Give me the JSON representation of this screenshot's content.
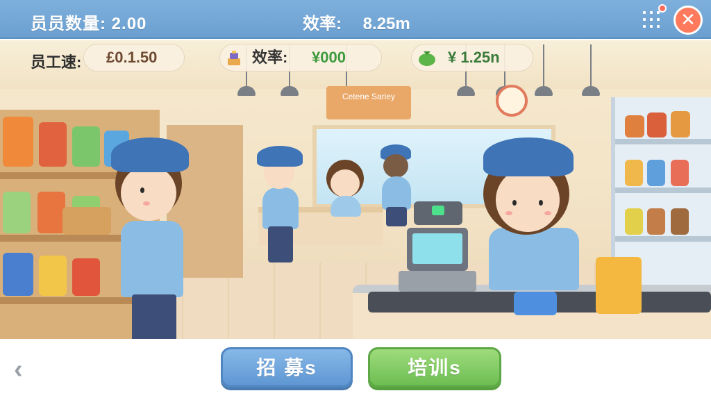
{
  "topbar": {
    "staff_count_label": "员员数量:",
    "staff_count_value": "2.00",
    "efficiency_label": "效率:",
    "efficiency_value": "8.25m",
    "menu_icon": "grid-icon",
    "close_icon": "close-icon",
    "close_glyph": "✕",
    "accent_color": "#6a9fd0",
    "close_color": "#ff7a5c"
  },
  "stats": {
    "staff_speed_label": "员工速:",
    "staff_speed_value": "£0.1.50",
    "efficiency_label": "效率:",
    "efficiency_value": "¥000",
    "income_value": "¥ 1.25n",
    "efficiency_icon": "stacked-boxes-icon",
    "income_icon": "money-bag-icon"
  },
  "scene": {
    "sign_text": "Cetene Sariey"
  },
  "bottombar": {
    "back_glyph": "‹",
    "recruit_label": "招 募s",
    "train_label": "培训s",
    "recruit_color": "#5f97d3",
    "train_color": "#6dbe52"
  }
}
